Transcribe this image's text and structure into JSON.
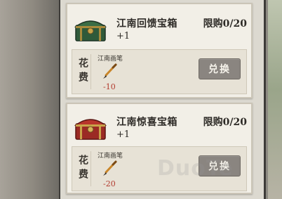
{
  "shop": {
    "items": [
      {
        "name": "江南回馈宝箱",
        "quantity": "+1",
        "limit": "限购0/20",
        "chest_icon": "green-treasure-chest-icon",
        "cost": {
          "label": "花费",
          "currency_name": "江南画笔",
          "currency_icon": "paintbrush-icon",
          "amount": "-10"
        },
        "button_label": "兑换"
      },
      {
        "name": "江南惊喜宝箱",
        "quantity": "+1",
        "limit": "限购0/20",
        "chest_icon": "red-treasure-chest-icon",
        "cost": {
          "label": "花费",
          "currency_name": "江南画笔",
          "currency_icon": "paintbrush-icon",
          "amount": "-20"
        },
        "button_label": "兑换"
      }
    ]
  },
  "watermark": "DuoTe",
  "colors": {
    "cost_red": "#b23a2e",
    "button_gray": "#8a8580",
    "card_bg": "#f2efe7"
  }
}
